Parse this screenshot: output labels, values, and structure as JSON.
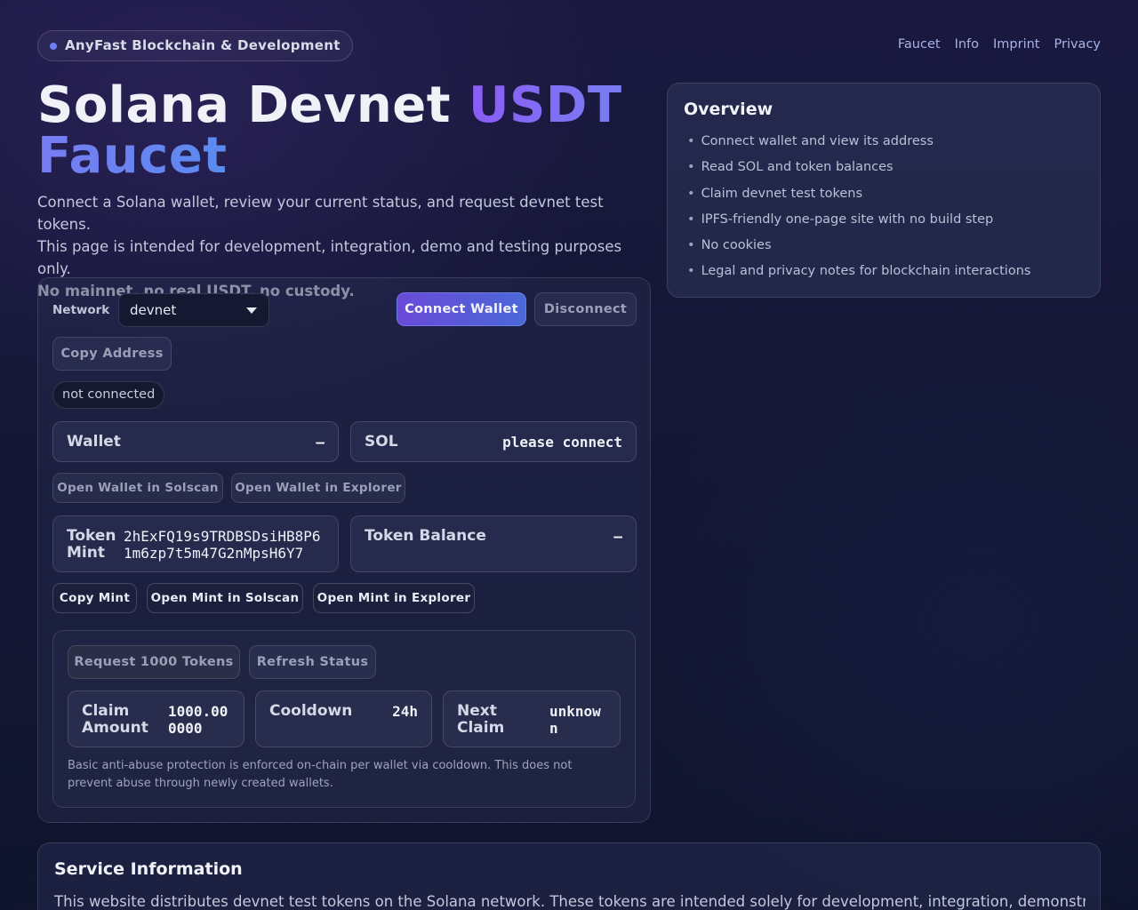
{
  "header": {
    "brand": "AnyFast Blockchain & Development",
    "nav": [
      "Faucet",
      "Info",
      "Imprint",
      "Privacy"
    ]
  },
  "hero": {
    "title_part1": "Solana Devnet ",
    "title_part2": "USDT Faucet",
    "intro_line1": "Connect a Solana wallet, review your current status, and request devnet test tokens.",
    "intro_line2": "This page is intended for development, integration, demo and testing purposes only.",
    "intro_bold": "No mainnet, no real USDT, no custody."
  },
  "wallet": {
    "network_label": "Network",
    "network_value": "devnet",
    "connect_label": "Connect Wallet",
    "disconnect_label": "Disconnect",
    "copy_address_label": "Copy Address",
    "status": "not connected",
    "wallet_label": "Wallet",
    "wallet_value": "–",
    "sol_label": "SOL",
    "sol_value": "please connect",
    "open_solscan_label": "Open Wallet in Solscan",
    "open_explorer_label": "Open Wallet in Explorer",
    "token_mint_label_1": "Token",
    "token_mint_label_2": "Mint",
    "token_mint_value_1": "2hExFQ19s9TRDBSDsiHB8P6",
    "token_mint_value_2": "1m6zp7t5m47G2nMpsH6Y7",
    "token_balance_label": "Token Balance",
    "token_balance_value": "–",
    "copy_mint_label": "Copy Mint",
    "mint_solscan_label": "Open Mint in Solscan",
    "mint_explorer_label": "Open Mint in Explorer"
  },
  "claim": {
    "request_label": "Request 1000 Tokens",
    "refresh_label": "Refresh Status",
    "amount_label_1": "Claim",
    "amount_label_2": "Amount",
    "amount_value_1": "1000.00",
    "amount_value_2": "0000",
    "cooldown_label": "Cooldown",
    "cooldown_value": "24h",
    "next_label_1": "Next",
    "next_label_2": "Claim",
    "next_value_1": "unknow",
    "next_value_2": "n",
    "note": "Basic anti-abuse protection is enforced on-chain per wallet via cooldown. This does not prevent abuse through newly created wallets."
  },
  "overview": {
    "title": "Overview",
    "items": [
      "Connect wallet and view its address",
      "Read SOL and token balances",
      "Claim devnet test tokens",
      "IPFS-friendly one-page site with no build step",
      "No cookies",
      "Legal and privacy notes for blockchain interactions"
    ]
  },
  "service": {
    "title": "Service Information",
    "text": "This website distributes devnet test tokens on the Solana network. These tokens are intended solely for development, integration, demonstration,"
  }
}
